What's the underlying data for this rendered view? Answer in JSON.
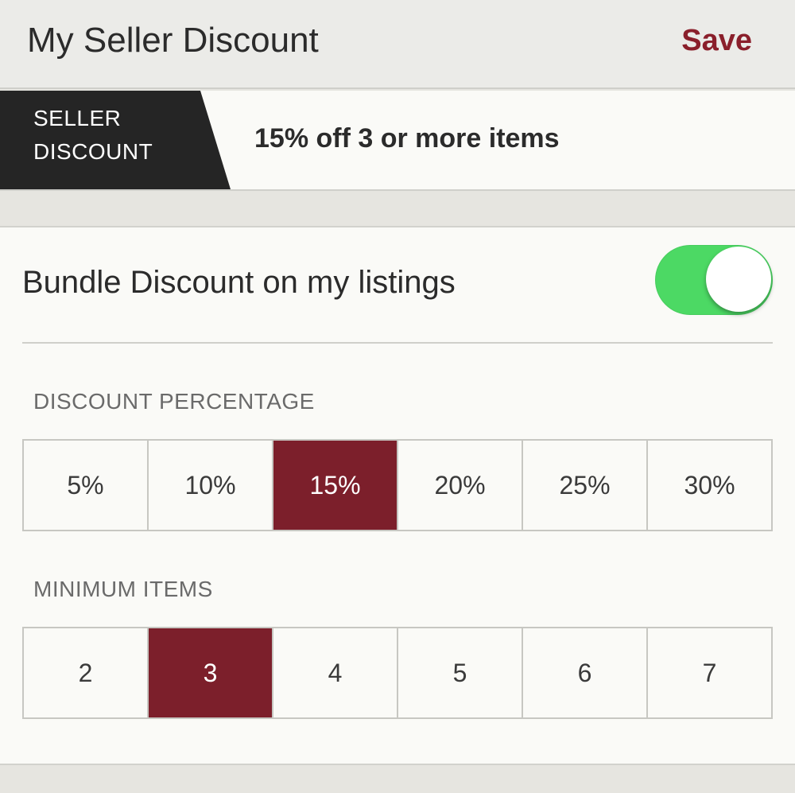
{
  "header": {
    "title": "My Seller Discount",
    "save_label": "Save"
  },
  "summary": {
    "tag_line1": "SELLER",
    "tag_line2": "DISCOUNT",
    "text": "15% off 3 or more items"
  },
  "bundle": {
    "label": "Bundle Discount on my listings",
    "enabled": true
  },
  "discount_percentage": {
    "label": "DISCOUNT PERCENTAGE",
    "options": [
      "5%",
      "10%",
      "15%",
      "20%",
      "25%",
      "30%"
    ],
    "selected_index": 2
  },
  "minimum_items": {
    "label": "MINIMUM ITEMS",
    "options": [
      "2",
      "3",
      "4",
      "5",
      "6",
      "7"
    ],
    "selected_index": 1
  },
  "colors": {
    "accent": "#7c1f2b",
    "save_text": "#8a1f2b",
    "toggle_on": "#4cd964",
    "tag_background": "#252525"
  }
}
